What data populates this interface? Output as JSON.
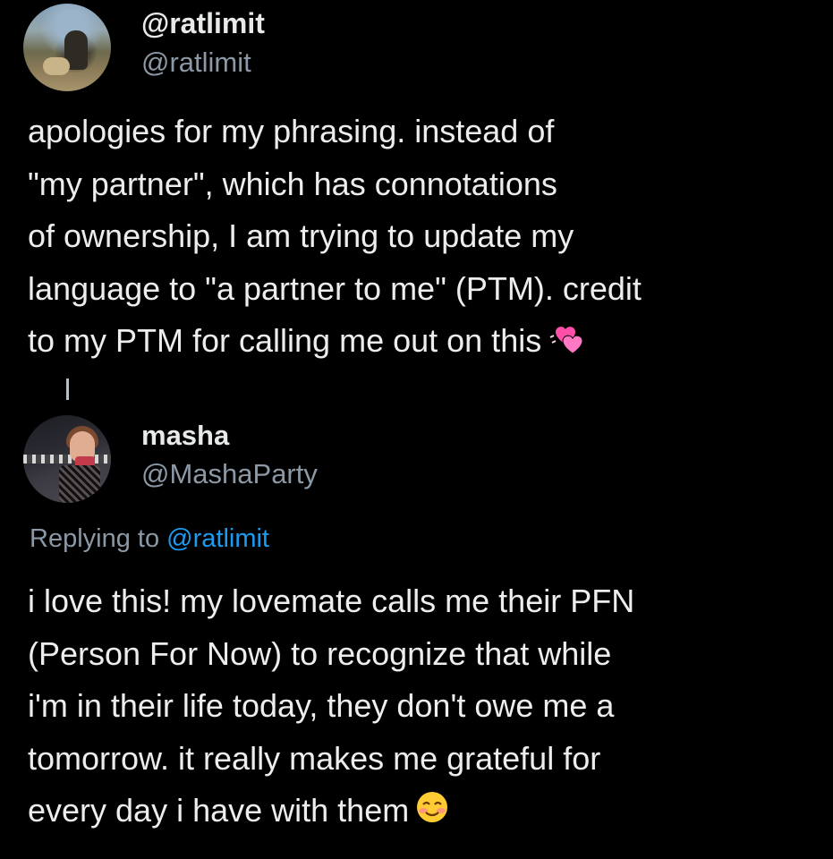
{
  "tweet_main": {
    "display_name": "@ratlimit",
    "handle": "@ratlimit",
    "text": "apologies for my phrasing. instead of\n\"my partner\", which has connotations\nof ownership, I am trying to update my\nlanguage to \"a partner to me\" (PTM). credit\nto my PTM for calling me out on this",
    "emoji": "two-hearts-emoji"
  },
  "tweet_reply": {
    "display_name": "masha",
    "handle": "@MashaParty",
    "replying_prefix": "Replying to",
    "replying_handle": "@ratlimit",
    "text": "i love this! my lovemate calls me their PFN\n(Person For Now) to recognize that while\ni'm in their life today, they don't owe me a\ntomorrow. it really makes me grateful for\nevery day i have with them",
    "emoji": "smiling-face-emoji"
  },
  "colors": {
    "background": "#000000",
    "text_primary": "#e7e9ea",
    "text_secondary": "#8b98a5",
    "link": "#1d9bf0"
  }
}
